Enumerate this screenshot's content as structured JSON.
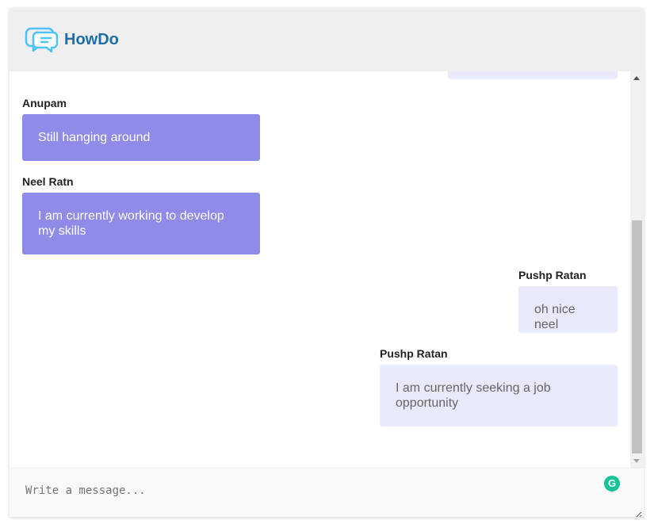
{
  "app": {
    "title": "HowDo",
    "logo_icon": "chat-bubbles-icon",
    "brand_color": "#1e6fa8",
    "logo_color": "#4fc3f7"
  },
  "messages": [
    {
      "sender": "Anupam",
      "text": "Still hanging around",
      "direction": "received"
    },
    {
      "sender": "Neel Ratn",
      "text": "I am currently working to develop my skills",
      "direction": "received"
    },
    {
      "sender": "Pushp Ratan",
      "text": "oh nice neel",
      "direction": "sent"
    },
    {
      "sender": "Pushp Ratan",
      "text": "I am currently seeking a job opportunity",
      "direction": "sent"
    }
  ],
  "colors": {
    "received_bubble": "#8e8ce8",
    "sent_bubble": "#e9e9fc",
    "header_bg": "#efefef"
  },
  "composer": {
    "placeholder": "Write a message...",
    "value": "",
    "assistant_icon": "grammarly-icon"
  }
}
